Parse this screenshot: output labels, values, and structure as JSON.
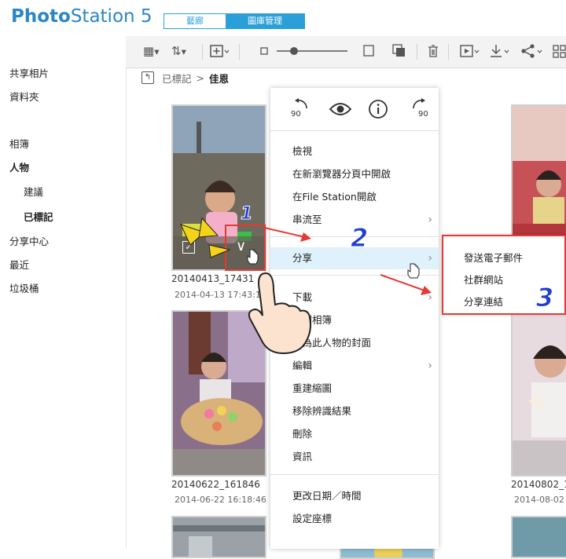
{
  "app": {
    "brand_bold": "Photo",
    "brand_rest": "Station 5"
  },
  "header_tabs": [
    {
      "label": "藝廊",
      "active": false
    },
    {
      "label": "圖庫管理",
      "active": true
    }
  ],
  "sidebar": {
    "items": [
      {
        "label": "共享相片",
        "bold": false
      },
      {
        "label": "資料夾",
        "bold": false
      },
      {
        "label": "相簿",
        "bold": false
      },
      {
        "label": "人物",
        "bold": true
      },
      {
        "label": "建議",
        "bold": false
      },
      {
        "label": "已標記",
        "bold": true
      },
      {
        "label": "分享中心",
        "bold": false
      },
      {
        "label": "最近",
        "bold": false
      },
      {
        "label": "垃圾桶",
        "bold": false
      }
    ]
  },
  "breadcrumb": {
    "parent": "已標記",
    "separator": ">",
    "current": "佳恩"
  },
  "thumbnails": [
    {
      "name": "20140413_17431",
      "date": "2014-04-13 17:43:1"
    },
    {
      "name": "20140622_161846",
      "date": "2014-06-22 16:18:46"
    },
    {
      "name": "20140802_1",
      "date": "2014-08-02 2"
    }
  ],
  "menu": {
    "icon_rotate_left": "90",
    "icon_rotate_right": "90",
    "items": [
      {
        "label": "檢視",
        "chevron": false
      },
      {
        "label": "在新瀏覽器分頁中開啟",
        "chevron": false
      },
      {
        "label": "在File Station開啟",
        "chevron": false
      },
      {
        "label": "串流至",
        "chevron": true
      },
      {
        "label": "分享",
        "chevron": true,
        "highlighted": true
      },
      {
        "label": "下載",
        "chevron": true
      },
      {
        "label": "加到相簿",
        "chevron": false
      },
      {
        "label": "設為此人物的封面",
        "chevron": false
      },
      {
        "label": "編輯",
        "chevron": true
      },
      {
        "label": "重建縮圖",
        "chevron": false
      },
      {
        "label": "移除辨識結果",
        "chevron": false
      },
      {
        "label": "刪除",
        "chevron": false
      },
      {
        "label": "資訊",
        "chevron": false
      },
      {
        "label": "更改日期／時間",
        "chevron": false
      },
      {
        "label": "設定座標",
        "chevron": false
      }
    ]
  },
  "submenu": {
    "items": [
      {
        "label": "發送電子郵件"
      },
      {
        "label": "社群網站"
      },
      {
        "label": "分享連結"
      }
    ]
  },
  "annotations": {
    "step2": "2",
    "step3": "3"
  },
  "colors": {
    "accent": "#2ba0d8",
    "brand": "#2b86c5",
    "highlight": "#dff2fb",
    "annotation_red": "#e53935",
    "annotation_blue": "#1f3fd1"
  }
}
